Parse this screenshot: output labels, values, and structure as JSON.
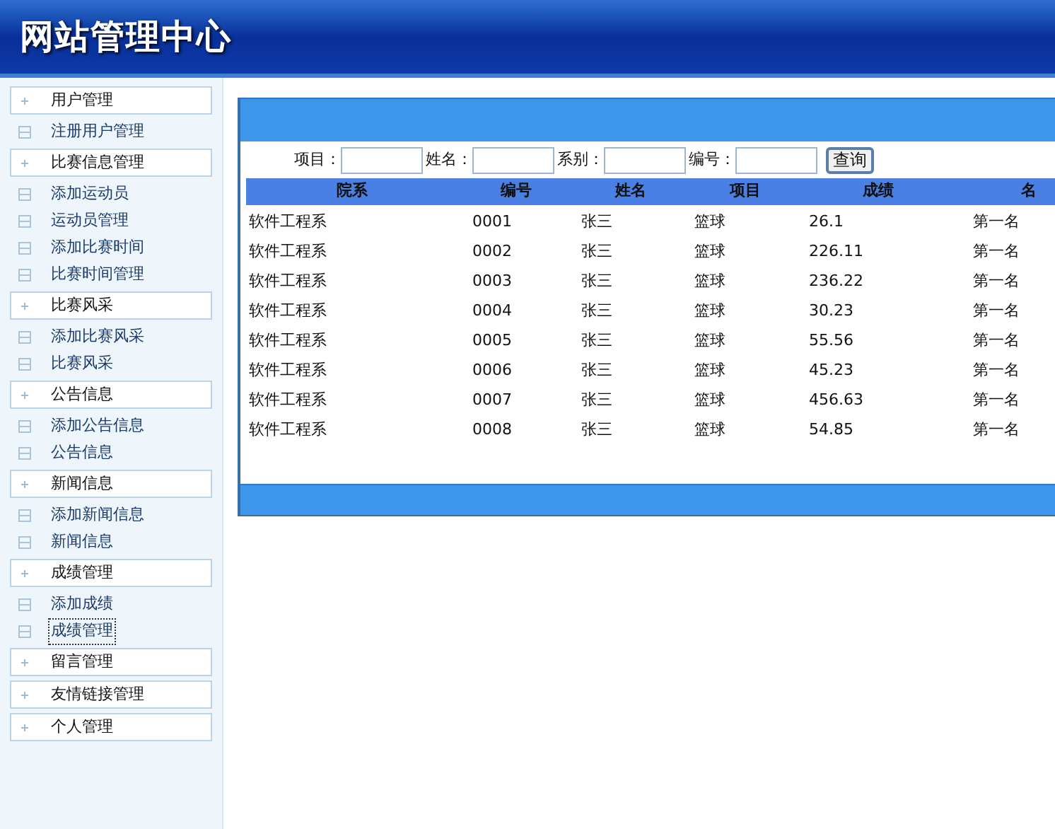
{
  "header": {
    "title": "网站管理中心"
  },
  "sidebar": {
    "sections": [
      {
        "label": "用户管理",
        "items": [
          {
            "label": "注册用户管理",
            "selected": false
          }
        ]
      },
      {
        "label": "比赛信息管理",
        "items": [
          {
            "label": "添加运动员",
            "selected": false
          },
          {
            "label": "运动员管理",
            "selected": false
          },
          {
            "label": "添加比赛时间",
            "selected": false
          },
          {
            "label": "比赛时间管理",
            "selected": false
          }
        ]
      },
      {
        "label": "比赛风采",
        "items": [
          {
            "label": "添加比赛风采",
            "selected": false
          },
          {
            "label": "比赛风采",
            "selected": false
          }
        ]
      },
      {
        "label": "公告信息",
        "items": [
          {
            "label": "添加公告信息",
            "selected": false
          },
          {
            "label": "公告信息",
            "selected": false
          }
        ]
      },
      {
        "label": "新闻信息",
        "items": [
          {
            "label": "添加新闻信息",
            "selected": false
          },
          {
            "label": "新闻信息",
            "selected": false
          }
        ]
      },
      {
        "label": "成绩管理",
        "items": [
          {
            "label": "添加成绩",
            "selected": false
          },
          {
            "label": "成绩管理",
            "selected": true
          }
        ]
      },
      {
        "label": "留言管理"
      },
      {
        "label": "友情链接管理"
      },
      {
        "label": "个人管理"
      }
    ]
  },
  "search": {
    "fields": [
      {
        "label": "项目："
      },
      {
        "label": "姓名："
      },
      {
        "label": "系别："
      },
      {
        "label": "编号："
      }
    ],
    "button": "查询"
  },
  "table": {
    "columns": [
      "院系",
      "编号",
      "姓名",
      "项目",
      "成绩",
      "名"
    ],
    "rows": [
      [
        "软件工程系",
        "0001",
        "张三",
        "篮球",
        "26.1",
        "第一名"
      ],
      [
        "软件工程系",
        "0002",
        "张三",
        "篮球",
        "226.11",
        "第一名"
      ],
      [
        "软件工程系",
        "0003",
        "张三",
        "篮球",
        "236.22",
        "第一名"
      ],
      [
        "软件工程系",
        "0004",
        "张三",
        "篮球",
        "30.23",
        "第一名"
      ],
      [
        "软件工程系",
        "0005",
        "张三",
        "篮球",
        "55.56",
        "第一名"
      ],
      [
        "软件工程系",
        "0006",
        "张三",
        "篮球",
        "45.23",
        "第一名"
      ],
      [
        "软件工程系",
        "0007",
        "张三",
        "篮球",
        "456.63",
        "第一名"
      ],
      [
        "软件工程系",
        "0008",
        "张三",
        "篮球",
        "54.85",
        "第一名"
      ]
    ]
  }
}
